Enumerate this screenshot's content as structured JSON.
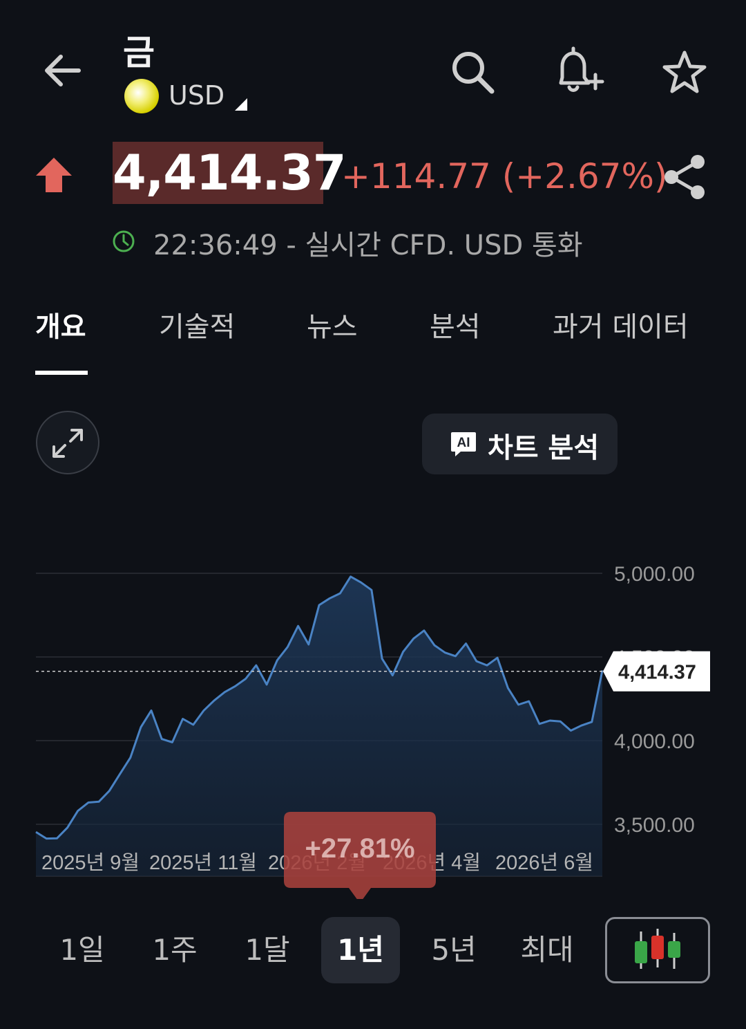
{
  "header": {
    "title": "금",
    "currency": "USD"
  },
  "quote": {
    "price": "4,414.37",
    "change": "+114.77 (+2.67%)",
    "timestamp": "22:36:49 - 실시간 CFD. USD 통화"
  },
  "tabs": [
    "개요",
    "기술적",
    "뉴스",
    "분석",
    "과거 데이터"
  ],
  "active_tab": 0,
  "tools": {
    "ai_badge": "AI",
    "ai_label": "차트 분석"
  },
  "ranges": [
    "1일",
    "1주",
    "1달",
    "1년",
    "5년",
    "최대"
  ],
  "active_range": "1년",
  "colors": {
    "background": "#0e1117",
    "up": "#e2665d",
    "price_highlight": "#5a2a2a",
    "line": "#4a83c4",
    "clock": "#4caf50"
  },
  "chart_data": {
    "type": "area",
    "ylim": [
      3300,
      5300
    ],
    "y_ticks": [
      3500,
      4000,
      4500,
      5000
    ],
    "y_tick_labels": [
      "3,500.00",
      "4,000.00",
      "4,500.00",
      "5,000.00"
    ],
    "x_tick_labels": [
      "2025년 9월",
      "2025년 11월",
      "2026년 2월",
      "2026년 4월",
      "2026년 6월"
    ],
    "current_value": 4414.37,
    "current_label": "4,414.37",
    "period_change_label": "+27.81%",
    "grid": true,
    "values": [
      3454,
      3415,
      3416,
      3480,
      3580,
      3630,
      3635,
      3700,
      3800,
      3898,
      4080,
      4180,
      4010,
      3990,
      4130,
      4095,
      4180,
      4240,
      4290,
      4325,
      4370,
      4450,
      4335,
      4480,
      4560,
      4685,
      4575,
      4810,
      4850,
      4880,
      4980,
      4945,
      4900,
      4490,
      4390,
      4530,
      4610,
      4658,
      4570,
      4526,
      4505,
      4580,
      4475,
      4450,
      4495,
      4315,
      4215,
      4235,
      4100,
      4120,
      4115,
      4060,
      4090,
      4112,
      4420
    ]
  }
}
